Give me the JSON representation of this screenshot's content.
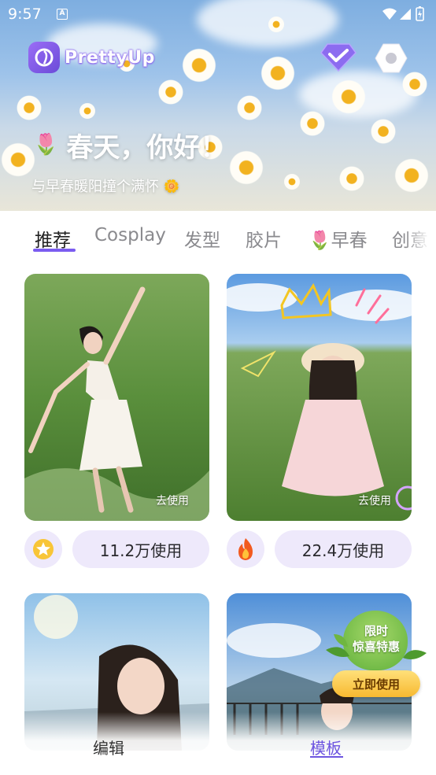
{
  "status_bar": {
    "time": "9:57",
    "notification_icon": "A"
  },
  "header": {
    "app_name": "PrettyUp",
    "vip_icon": "diamond-icon",
    "settings_icon": "settings-icon"
  },
  "greeting": {
    "title_emoji": "🌷",
    "title": "春天，你好！",
    "subtitle": "与早春暖阳撞个满怀",
    "subtitle_emoji": "🌼"
  },
  "tabs": [
    {
      "label": "推荐",
      "active": true
    },
    {
      "label": "Cosplay",
      "active": false
    },
    {
      "label": "发型",
      "active": false
    },
    {
      "label": "胶片",
      "active": false
    },
    {
      "label": "🌷早春",
      "active": false
    },
    {
      "label": "创意",
      "active": false
    }
  ],
  "cards": [
    {
      "use_label": "去使用",
      "badge_icon": "star-icon",
      "usage": "11.2万使用"
    },
    {
      "use_label": "去使用",
      "badge_icon": "fire-icon",
      "usage": "22.4万使用"
    }
  ],
  "promo": {
    "line1": "限时",
    "line2": "惊喜特惠",
    "button": "立即使用"
  },
  "bottom_nav": [
    {
      "label": "编辑",
      "active": false
    },
    {
      "label": "模板",
      "active": true
    }
  ],
  "colors": {
    "accent": "#7b5cf0",
    "pill_bg": "#eee9fb",
    "promo_button": "#f7b930"
  }
}
